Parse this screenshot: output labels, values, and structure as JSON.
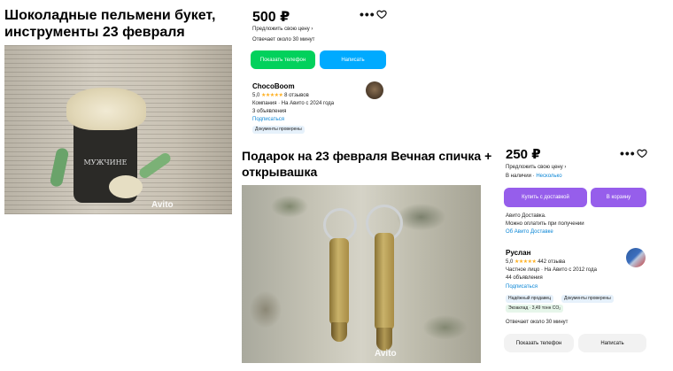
{
  "listings": [
    {
      "title": "Шоколадные пельмени букет, инструменты 23 февраля",
      "price": "500 ₽",
      "more_label": "•••",
      "favorite_icon": "heart-icon",
      "offer_price": "Предложить свою цену ›",
      "reply_time": "Отвечает около 30 минут",
      "buttons": {
        "phone": "Показать телефон",
        "write": "Написать"
      },
      "photo": {
        "cup_label": "МУЖЧИНЕ",
        "watermark": "Avito"
      },
      "seller": {
        "name": "ChocoBoom",
        "rating": "5,0",
        "stars": "★★★★★",
        "reviews": "8 отзывов",
        "company": "Компания · На Авито с 2024 года",
        "ads_count": "3 объявления",
        "subscribe": "Подписаться",
        "badges": [
          "Документы проверены"
        ]
      },
      "colors": {
        "phone_button": "#02d15c",
        "write_button": "#00aaff"
      }
    },
    {
      "title": "Подарок на 23 февраля Вечная спичка + открывашка",
      "price": "250 ₽",
      "more_label": "•••",
      "favorite_icon": "heart-icon",
      "offer_price": "Предложить свою цену ›",
      "delivery_prefix": "В наличии · ",
      "delivery_link": "Несколько",
      "buttons": {
        "buy_delivery": "Купить с доставкой",
        "to_cart": "В корзину",
        "phone": "Показать телефон",
        "write": "Написать"
      },
      "avito_delivery": {
        "line1": "Авито Доставка.",
        "line2": "Можно оплатить при получении",
        "link": "Об Авито Доставке"
      },
      "photo": {
        "watermark": "Avito"
      },
      "seller": {
        "name": "Руслан",
        "rating": "5,0",
        "stars": "★★★★★",
        "reviews": "442 отзыва",
        "person": "Частное лицо · На Авито с 2012 года",
        "ads_count": "44 объявления",
        "subscribe": "Подписаться",
        "badges": [
          "Надёжный продавец",
          "Документы проверены",
          "Экоаклад · 3,49 тонн CO₂"
        ]
      },
      "reply_time": "Отвечает около 30 минут",
      "colors": {
        "purple_button": "#965eeb",
        "grey_button": "#f2f2f2"
      }
    }
  ]
}
